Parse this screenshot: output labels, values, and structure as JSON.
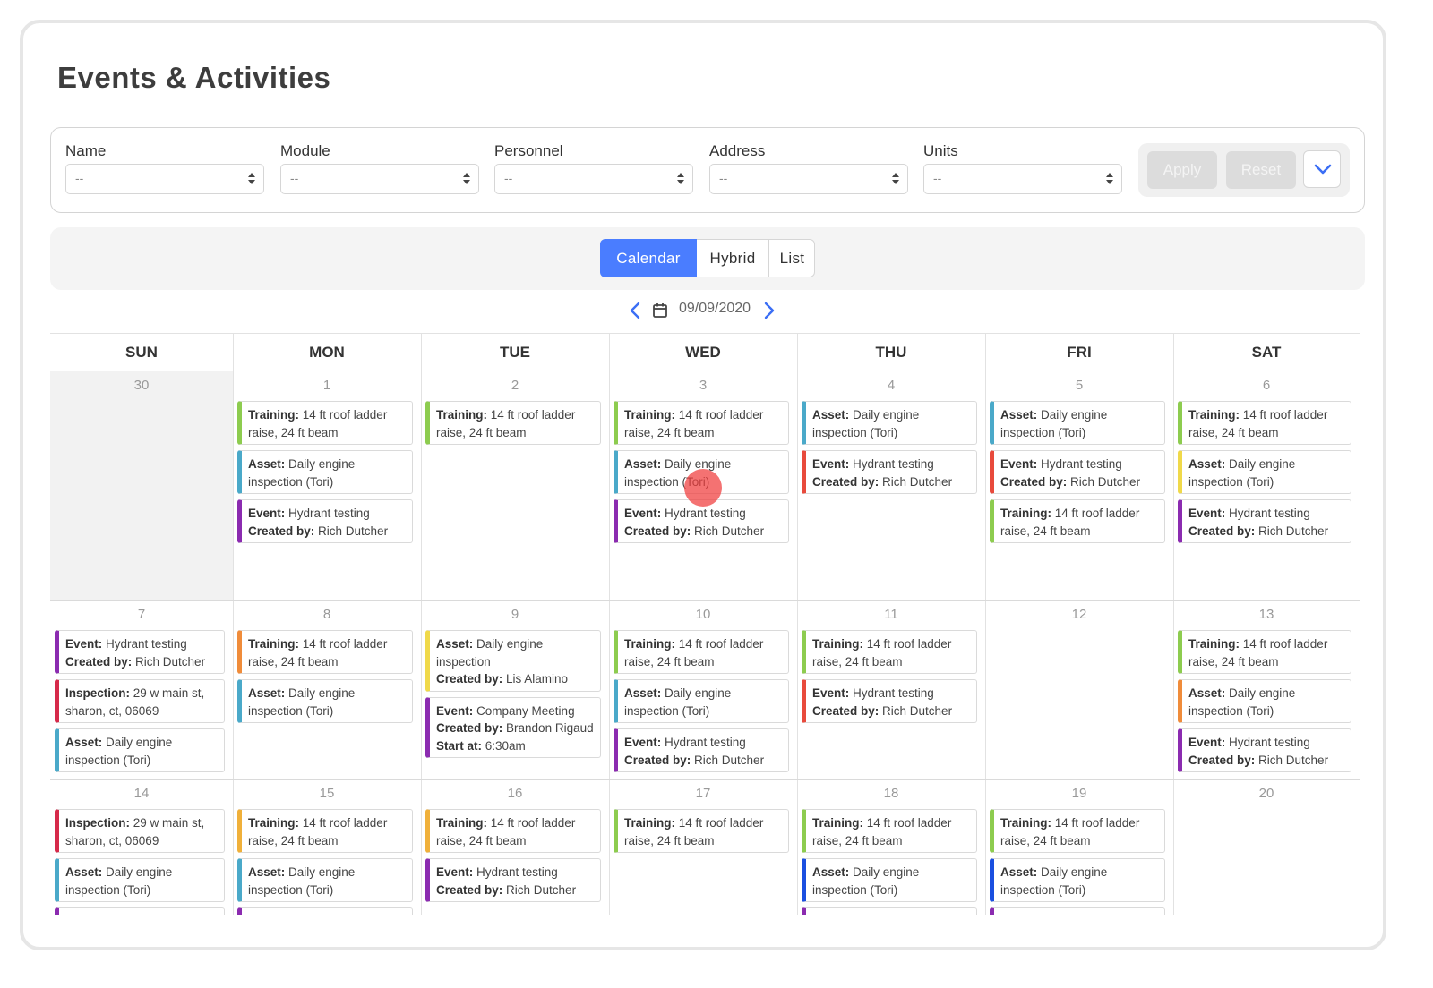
{
  "page": {
    "title": "Events & Activities"
  },
  "filters": {
    "items": [
      {
        "label": "Name",
        "value": "--"
      },
      {
        "label": "Module",
        "value": "--"
      },
      {
        "label": "Personnel",
        "value": "--"
      },
      {
        "label": "Address",
        "value": "--"
      },
      {
        "label": "Units",
        "value": "--"
      }
    ],
    "apply_label": "Apply",
    "reset_label": "Reset"
  },
  "views": {
    "calendar": "Calendar",
    "hybrid": "Hybrid",
    "list": "List",
    "active": "calendar"
  },
  "date_nav": {
    "date": "09/09/2020"
  },
  "colors": {
    "accent": "#4a7dff",
    "training": "#8dcc4f",
    "asset": "#4aa9c9",
    "event": "#8b2bb0",
    "inspection": "#d62a4a",
    "hydrant_red": "#e84a3c",
    "orange": "#f08c3a",
    "yellow": "#f0d94a",
    "blue": "#1a4fe0"
  },
  "calendar": {
    "weekdays": [
      "SUN",
      "MON",
      "TUE",
      "WED",
      "THU",
      "FRI",
      "SAT"
    ],
    "weeks": [
      [
        {
          "day": "30",
          "outside": true,
          "events": []
        },
        {
          "day": "1",
          "events": [
            {
              "color": "#8dcc4f",
              "lines": [
                [
                  "Training:",
                  " 14 ft roof ladder raise, 24 ft beam"
                ]
              ]
            },
            {
              "color": "#4aa9c9",
              "lines": [
                [
                  "Asset:",
                  " Daily engine inspection (Tori)"
                ]
              ]
            },
            {
              "color": "#8b2bb0",
              "lines": [
                [
                  "Event:",
                  " Hydrant testing"
                ],
                [
                  "Created by:",
                  " Rich Dutcher"
                ]
              ]
            }
          ]
        },
        {
          "day": "2",
          "events": [
            {
              "color": "#8dcc4f",
              "lines": [
                [
                  "Training:",
                  " 14 ft roof ladder raise, 24 ft beam"
                ]
              ]
            }
          ]
        },
        {
          "day": "3",
          "events": [
            {
              "color": "#8dcc4f",
              "lines": [
                [
                  "Training:",
                  " 14 ft roof ladder raise, 24 ft beam"
                ]
              ]
            },
            {
              "color": "#4aa9c9",
              "lines": [
                [
                  "Asset:",
                  " Daily engine inspection (Tori)"
                ]
              ]
            },
            {
              "color": "#8b2bb0",
              "lines": [
                [
                  "Event:",
                  " Hydrant testing"
                ],
                [
                  "Created by:",
                  " Rich Dutcher"
                ]
              ]
            }
          ]
        },
        {
          "day": "4",
          "events": [
            {
              "color": "#4aa9c9",
              "lines": [
                [
                  "Asset:",
                  " Daily engine inspection (Tori)"
                ]
              ]
            },
            {
              "color": "#e84a3c",
              "lines": [
                [
                  "Event:",
                  " Hydrant testing"
                ],
                [
                  "Created by:",
                  " Rich Dutcher"
                ]
              ]
            }
          ]
        },
        {
          "day": "5",
          "events": [
            {
              "color": "#4aa9c9",
              "lines": [
                [
                  "Asset:",
                  " Daily engine inspection (Tori)"
                ]
              ]
            },
            {
              "color": "#e84a3c",
              "lines": [
                [
                  "Event:",
                  " Hydrant testing"
                ],
                [
                  "Created by:",
                  " Rich Dutcher"
                ]
              ]
            },
            {
              "color": "#8dcc4f",
              "lines": [
                [
                  "Training:",
                  " 14 ft roof ladder raise, 24 ft beam"
                ]
              ]
            }
          ]
        },
        {
          "day": "6",
          "events": [
            {
              "color": "#8dcc4f",
              "lines": [
                [
                  "Training:",
                  " 14 ft roof ladder raise, 24 ft beam"
                ]
              ]
            },
            {
              "color": "#f0d94a",
              "lines": [
                [
                  "Asset:",
                  " Daily engine inspection (Tori)"
                ]
              ]
            },
            {
              "color": "#8b2bb0",
              "lines": [
                [
                  "Event:",
                  " Hydrant testing"
                ],
                [
                  "Created by:",
                  " Rich Dutcher"
                ]
              ]
            }
          ]
        }
      ],
      [
        {
          "day": "7",
          "events": [
            {
              "color": "#8b2bb0",
              "lines": [
                [
                  "Event:",
                  " Hydrant testing"
                ],
                [
                  "Created by:",
                  " Rich Dutcher"
                ]
              ]
            },
            {
              "color": "#d62a4a",
              "lines": [
                [
                  "Inspection:",
                  " 29 w main st, sharon, ct, 06069"
                ]
              ]
            },
            {
              "color": "#4aa9c9",
              "lines": [
                [
                  "Asset:",
                  " Daily engine inspection (Tori)"
                ]
              ]
            }
          ]
        },
        {
          "day": "8",
          "events": [
            {
              "color": "#f08c3a",
              "lines": [
                [
                  "Training:",
                  " 14 ft roof ladder raise, 24 ft beam"
                ]
              ]
            },
            {
              "color": "#4aa9c9",
              "lines": [
                [
                  "Asset:",
                  " Daily engine inspection (Tori)"
                ]
              ]
            }
          ]
        },
        {
          "day": "9",
          "events": [
            {
              "color": "#f0d94a",
              "lines": [
                [
                  "Asset:",
                  " Daily engine inspection"
                ],
                [
                  "Created by:",
                  " Lis Alamino"
                ]
              ]
            },
            {
              "color": "#8b2bb0",
              "lines": [
                [
                  "Event:",
                  " Company Meeting"
                ],
                [
                  "Created by:",
                  " Brandon Rigaud"
                ],
                [
                  "Start at:",
                  " 6:30am"
                ]
              ]
            }
          ]
        },
        {
          "day": "10",
          "events": [
            {
              "color": "#8dcc4f",
              "lines": [
                [
                  "Training:",
                  " 14 ft roof ladder raise, 24 ft beam"
                ]
              ]
            },
            {
              "color": "#4aa9c9",
              "lines": [
                [
                  "Asset:",
                  " Daily engine inspection (Tori)"
                ]
              ]
            },
            {
              "color": "#8b2bb0",
              "lines": [
                [
                  "Event:",
                  " Hydrant testing"
                ],
                [
                  "Created by:",
                  " Rich Dutcher"
                ]
              ]
            }
          ]
        },
        {
          "day": "11",
          "events": [
            {
              "color": "#8dcc4f",
              "lines": [
                [
                  "Training:",
                  " 14 ft roof ladder raise, 24 ft beam"
                ]
              ]
            },
            {
              "color": "#e84a3c",
              "lines": [
                [
                  "Event:",
                  " Hydrant testing"
                ],
                [
                  "Created by:",
                  " Rich Dutcher"
                ]
              ]
            }
          ]
        },
        {
          "day": "12",
          "events": []
        },
        {
          "day": "13",
          "events": [
            {
              "color": "#8dcc4f",
              "lines": [
                [
                  "Training:",
                  " 14 ft roof ladder raise, 24 ft beam"
                ]
              ]
            },
            {
              "color": "#f08c3a",
              "lines": [
                [
                  "Asset:",
                  " Daily engine inspection (Tori)"
                ]
              ]
            },
            {
              "color": "#8b2bb0",
              "lines": [
                [
                  "Event:",
                  " Hydrant testing"
                ],
                [
                  "Created by:",
                  " Rich Dutcher"
                ]
              ]
            }
          ]
        }
      ],
      [
        {
          "day": "14",
          "events": [
            {
              "color": "#d62a4a",
              "lines": [
                [
                  "Inspection:",
                  " 29 w main st, sharon, ct, 06069"
                ]
              ]
            },
            {
              "color": "#4aa9c9",
              "lines": [
                [
                  "Asset:",
                  " Daily engine inspection (Tori)"
                ]
              ]
            },
            {
              "color": "#8b2bb0",
              "lines": []
            }
          ]
        },
        {
          "day": "15",
          "events": [
            {
              "color": "#f0b03a",
              "lines": [
                [
                  "Training:",
                  " 14 ft roof ladder raise, 24 ft beam"
                ]
              ]
            },
            {
              "color": "#4aa9c9",
              "lines": [
                [
                  "Asset:",
                  " Daily engine inspection (Tori)"
                ]
              ]
            },
            {
              "color": "#8b2bb0",
              "lines": []
            }
          ]
        },
        {
          "day": "16",
          "events": [
            {
              "color": "#f0b03a",
              "lines": [
                [
                  "Training:",
                  " 14 ft roof ladder raise, 24 ft beam"
                ]
              ]
            },
            {
              "color": "#8b2bb0",
              "lines": [
                [
                  "Event:",
                  " Hydrant testing"
                ],
                [
                  "Created by:",
                  " Rich Dutcher"
                ]
              ]
            }
          ]
        },
        {
          "day": "17",
          "events": [
            {
              "color": "#8dcc4f",
              "lines": [
                [
                  "Training:",
                  " 14 ft roof ladder raise, 24 ft beam"
                ]
              ]
            }
          ]
        },
        {
          "day": "18",
          "events": [
            {
              "color": "#8dcc4f",
              "lines": [
                [
                  "Training:",
                  " 14 ft roof ladder raise, 24 ft beam"
                ]
              ]
            },
            {
              "color": "#1a4fe0",
              "lines": [
                [
                  "Asset:",
                  " Daily engine inspection (Tori)"
                ]
              ]
            },
            {
              "color": "#8b2bb0",
              "lines": []
            }
          ]
        },
        {
          "day": "19",
          "events": [
            {
              "color": "#8dcc4f",
              "lines": [
                [
                  "Training:",
                  " 14 ft roof ladder raise, 24 ft beam"
                ]
              ]
            },
            {
              "color": "#1a4fe0",
              "lines": [
                [
                  "Asset:",
                  " Daily engine inspection (Tori)"
                ]
              ]
            },
            {
              "color": "#8b2bb0",
              "lines": []
            }
          ]
        },
        {
          "day": "20",
          "events": []
        }
      ]
    ]
  }
}
